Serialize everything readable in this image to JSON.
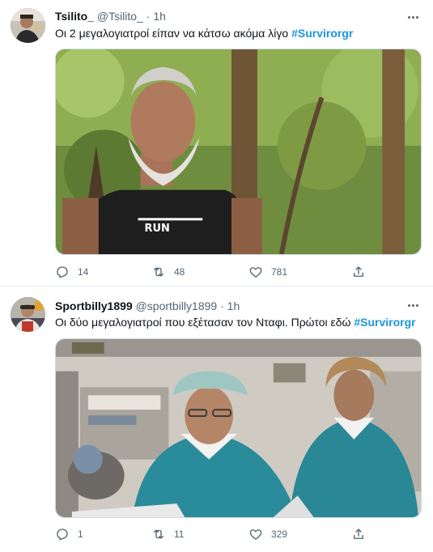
{
  "tweets": [
    {
      "name": "Tsilito_",
      "handle": "@Tsilito_",
      "separator": "·",
      "time": "1h",
      "text": "Οι 2 μεγαλογιατροί είπαν να κάτσω ακόμα λίγο",
      "hashtag": "#Survirorgr",
      "replies": "14",
      "retweets": "48",
      "likes": "781"
    },
    {
      "name": "Sportbilly1899",
      "handle": "@sportbilly1899",
      "separator": "·",
      "time": "1h",
      "text": "Οι δύο μεγαλογιατροί που εξέτασαν τον Νταφι. Πρώτοι εδώ",
      "hashtag": "#Survirorgr",
      "replies": "1",
      "retweets": "11",
      "likes": "329"
    }
  ],
  "icons": {
    "more": "more-horizontal-icon",
    "reply": "reply-icon",
    "retweet": "retweet-icon",
    "like": "heart-icon",
    "share": "share-icon"
  },
  "colors": {
    "hashtag": "#1b95e0",
    "secondary_text": "#536471",
    "divider": "#e6ecf0"
  }
}
